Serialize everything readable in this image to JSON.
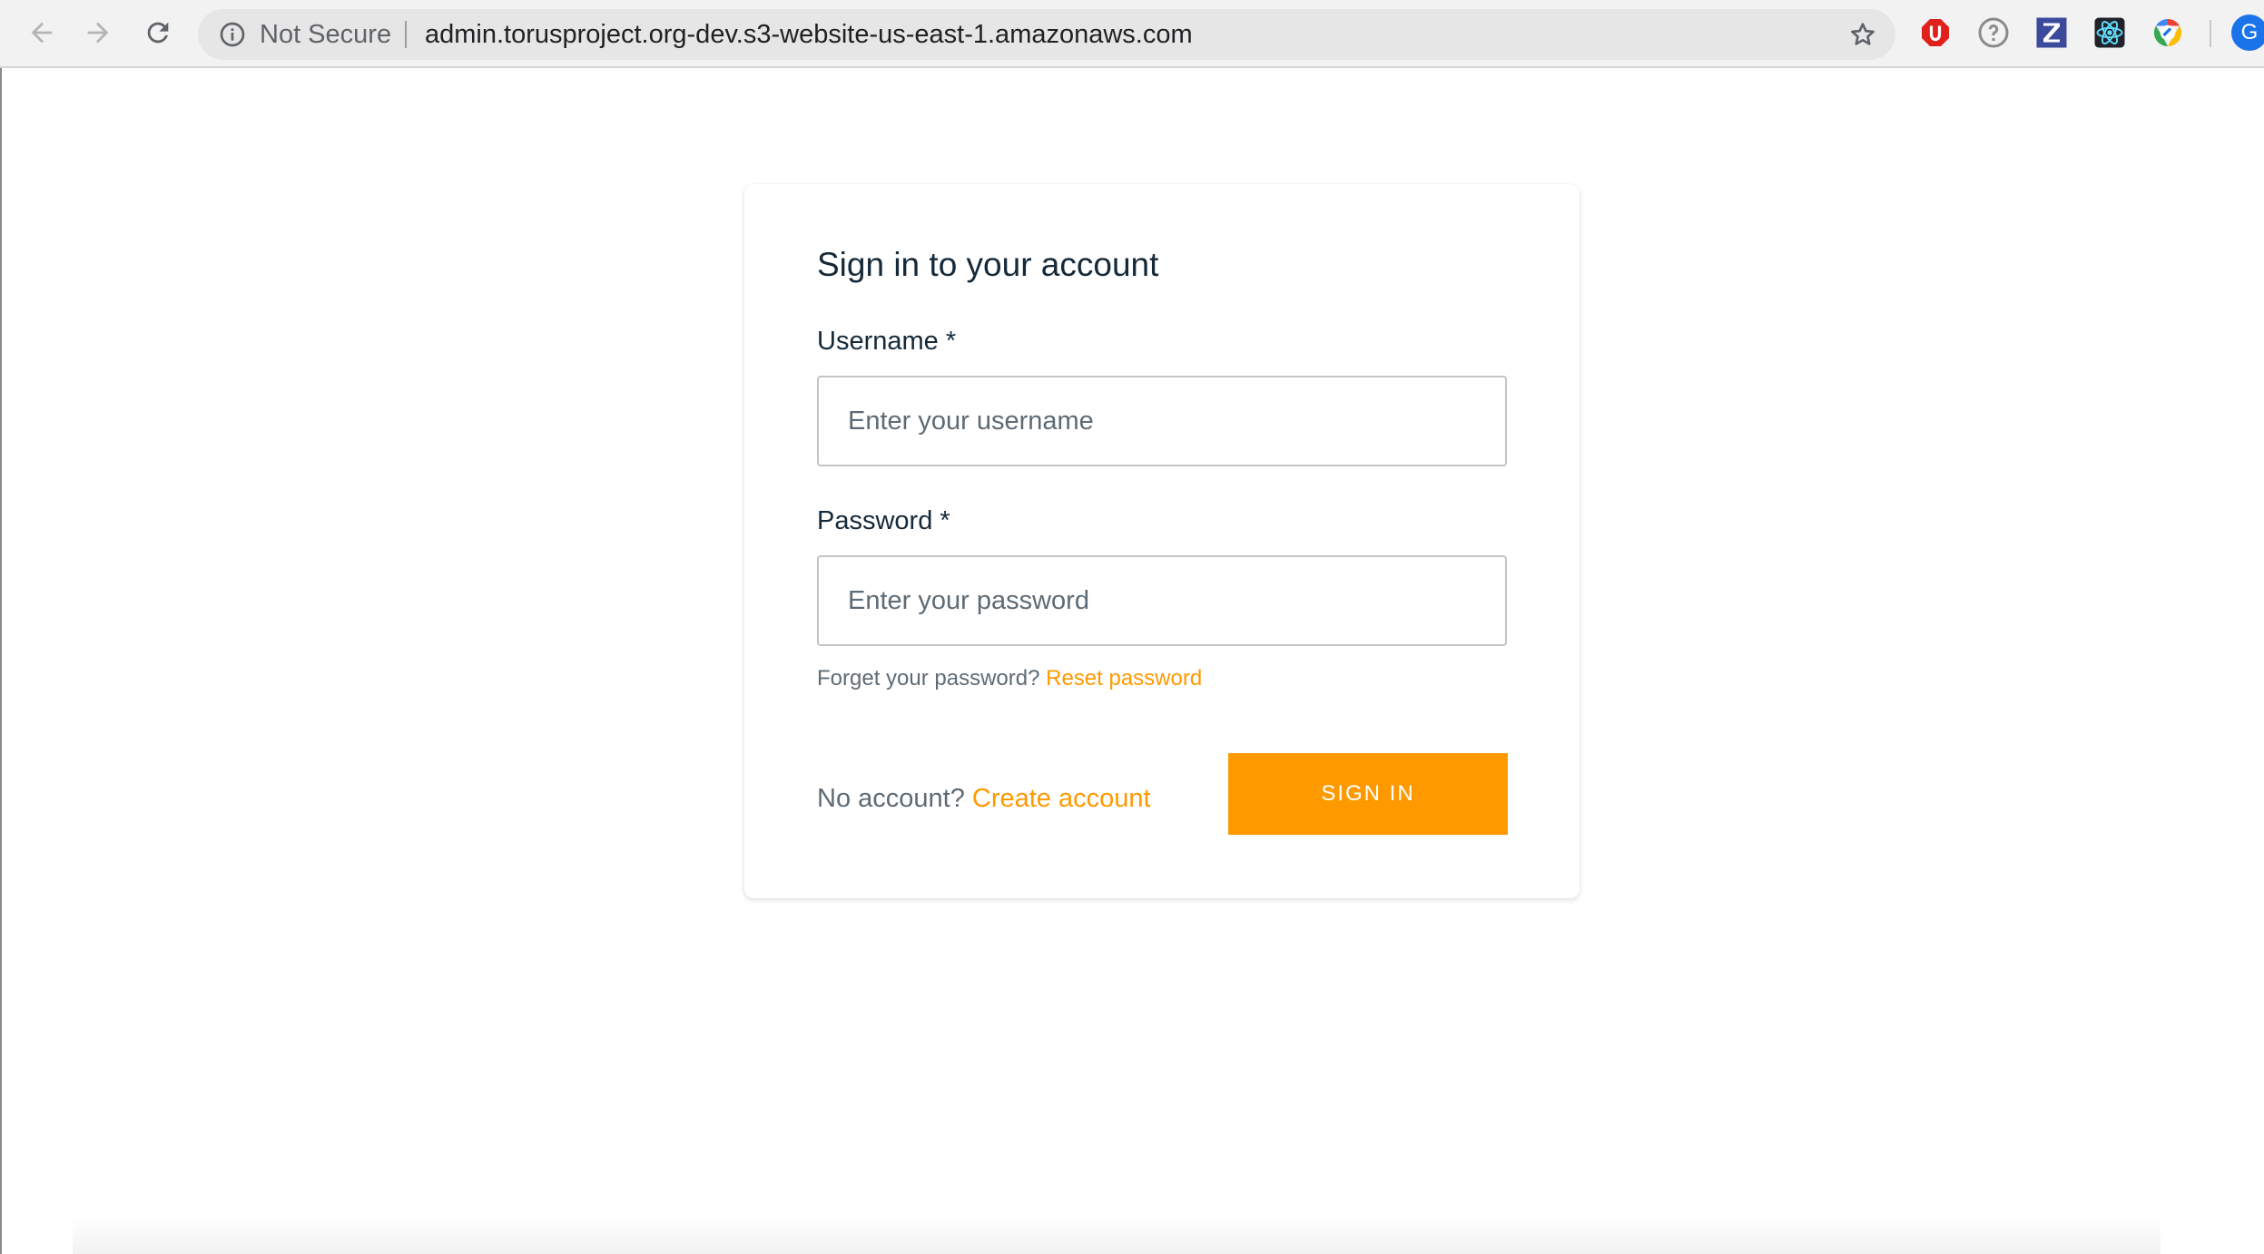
{
  "browser": {
    "security_label": "Not Secure",
    "url": "admin.torusproject.org-dev.s3-website-us-east-1.amazonaws.com",
    "nav_icons": [
      "back-arrow-icon",
      "forward-arrow-icon",
      "reload-icon"
    ],
    "extensions": [
      "ublock-icon",
      "help-icon",
      "zotero-icon",
      "react-devtools-icon",
      "chrome-color-icon"
    ],
    "profile_initial": "G",
    "colors": {
      "toolbar_bg": "#f2f2f2",
      "omnibox_bg": "#e6e6e6",
      "profile": "#1a73e8"
    }
  },
  "signin": {
    "title": "Sign in to your account",
    "username": {
      "label": "Username *",
      "placeholder": "Enter your username",
      "value": ""
    },
    "password": {
      "label": "Password *",
      "placeholder": "Enter your password",
      "value": ""
    },
    "forgot_text": "Forget your password?",
    "reset_link": "Reset password",
    "no_account_text": "No account?",
    "create_account_link": "Create account",
    "submit_label": "SIGN IN",
    "colors": {
      "accent": "#ff9900",
      "text": "#152939",
      "muted": "#5e6b75"
    }
  }
}
